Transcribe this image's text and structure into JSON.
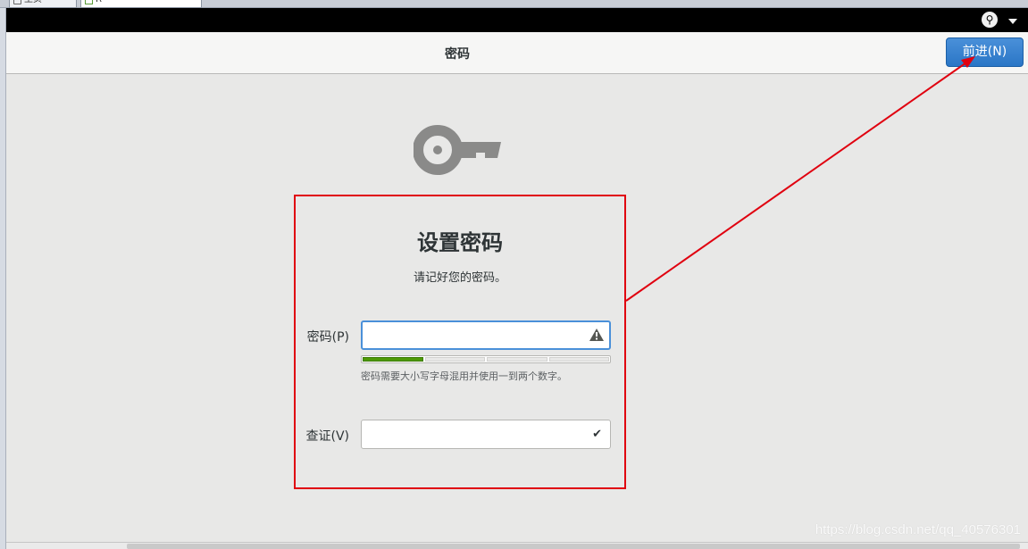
{
  "host_tabs": [
    {
      "label": "主页"
    },
    {
      "label": "R"
    }
  ],
  "header": {
    "title": "密码",
    "next_label": "前进(N)"
  },
  "dialog": {
    "title": "设置密码",
    "subtitle": "请记好您的密码。",
    "password_label": "密码(P)",
    "password_value": "",
    "strength_level_fraction": 0.25,
    "hint": "密码需要大小写字母混用并使用一到两个数字。",
    "verify_label": "查证(V)",
    "verify_value": ""
  },
  "icons": {
    "accessibility": "accessibility-icon",
    "key": "key-icon",
    "warning": "warning-icon",
    "check": "check-icon"
  },
  "colors": {
    "accent": "#4a90d9",
    "strength": "#4e9a06",
    "annotation": "#e0000f"
  },
  "watermark": "https://blog.csdn.net/qq_40576301"
}
